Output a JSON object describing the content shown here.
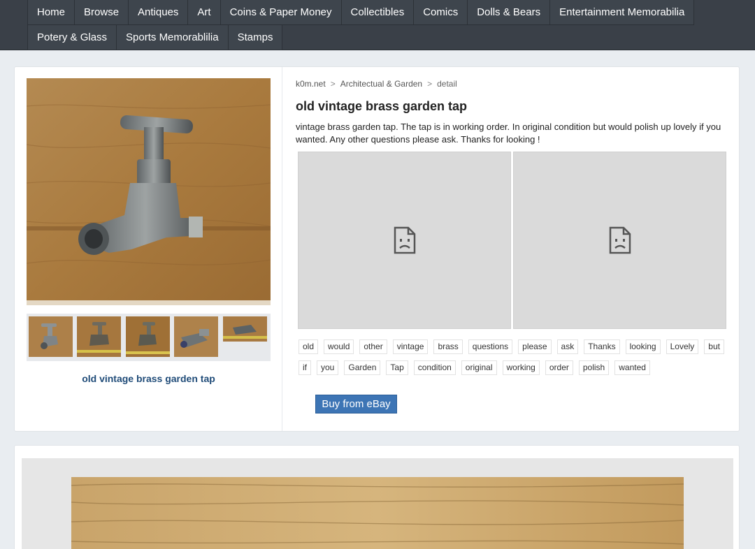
{
  "nav": {
    "row1": [
      "Home",
      "Browse",
      "Antiques",
      "Art",
      "Coins & Paper Money",
      "Collectibles",
      "Comics",
      "Dolls & Bears",
      "Entertainment Memorabilia"
    ],
    "row2": [
      "Potery & Glass",
      "Sports Memorablilia",
      "Stamps"
    ]
  },
  "breadcrumb": {
    "site": "k0m.net",
    "category": "Architectual & Garden",
    "current": "detail",
    "separator": ">"
  },
  "item": {
    "title": "old vintage brass garden tap",
    "description": "vintage brass garden tap. The tap is in working order. In original condition but would polish up lovely if you wanted. Any other questions please ask. Thanks for looking !",
    "left_title": "old vintage brass garden tap"
  },
  "embeds": [
    {
      "icon": "broken-page-icon"
    },
    {
      "icon": "broken-page-icon"
    }
  ],
  "tags": {
    "row1": [
      "old",
      "would",
      "other",
      "vintage",
      "brass",
      "questions",
      "please",
      "ask",
      "Thanks",
      "looking",
      "Lovely",
      "but"
    ],
    "row2": [
      "if",
      "you",
      "Garden",
      "Tap",
      "condition",
      "original",
      "working",
      "order",
      "polish",
      "wanted"
    ]
  },
  "buy_button": "Buy from eBay",
  "colors": {
    "nav_bg": "#3a4048",
    "title_link": "#1f4b78",
    "buy_button": "#3d75b5",
    "page_bg": "#e9edf1"
  }
}
